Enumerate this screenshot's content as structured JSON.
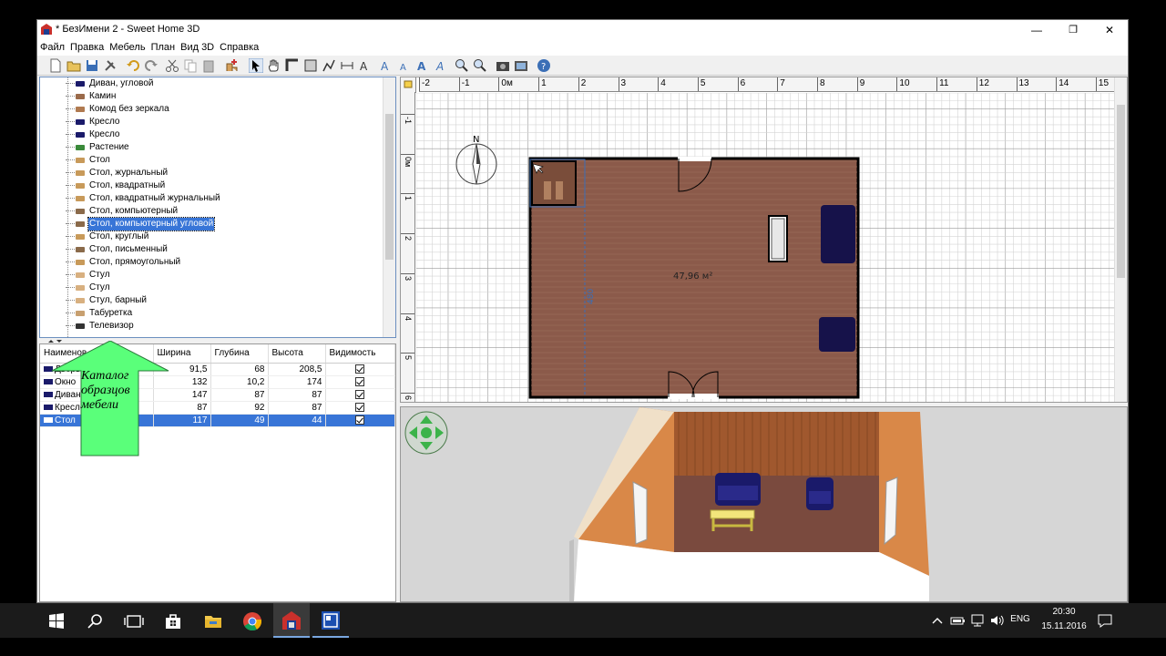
{
  "window": {
    "title": "* БезИмени 2 - Sweet Home 3D",
    "controls": {
      "minimize": "—",
      "maximize": "❐",
      "close": "✕"
    }
  },
  "menu": [
    "Файл",
    "Правка",
    "Мебель",
    "План",
    "Вид 3D",
    "Справка"
  ],
  "catalog": {
    "items": [
      {
        "label": "Диван, угловой",
        "icon": "sofa-icon"
      },
      {
        "label": "Камин",
        "icon": "fireplace-icon"
      },
      {
        "label": "Комод без зеркала",
        "icon": "dresser-icon"
      },
      {
        "label": "Кресло",
        "icon": "armchair-icon"
      },
      {
        "label": "Кресло",
        "icon": "armchair-icon"
      },
      {
        "label": "Растение",
        "icon": "plant-icon"
      },
      {
        "label": "Стол",
        "icon": "table-icon"
      },
      {
        "label": "Стол, журнальный",
        "icon": "table-icon"
      },
      {
        "label": "Стол, квадратный",
        "icon": "table-icon"
      },
      {
        "label": "Стол, квадратный журнальный",
        "icon": "table-icon"
      },
      {
        "label": "Стол, компьютерный",
        "icon": "desk-icon"
      },
      {
        "label": "Стол, компьютерный угловой",
        "icon": "desk-icon",
        "selected": true
      },
      {
        "label": "Стол, круглый",
        "icon": "table-icon"
      },
      {
        "label": "Стол, письменный",
        "icon": "desk-icon"
      },
      {
        "label": "Стол, прямоугольный",
        "icon": "table-icon"
      },
      {
        "label": "Стул",
        "icon": "chair-icon"
      },
      {
        "label": "Стул",
        "icon": "chair-icon"
      },
      {
        "label": "Стул, барный",
        "icon": "chair-icon"
      },
      {
        "label": "Табуретка",
        "icon": "stool-icon"
      },
      {
        "label": "Телевизор",
        "icon": "tv-icon"
      }
    ]
  },
  "furniture_table": {
    "headers": [
      "Наименов",
      "Ширина",
      "Глубина",
      "Высота",
      "Видимость"
    ],
    "rows": [
      {
        "name": "Дверь",
        "width": "91,5",
        "depth": "68",
        "height": "208,5",
        "visible": true,
        "icon": "door-icon"
      },
      {
        "name": "Окно",
        "width": "132",
        "depth": "10,2",
        "height": "174",
        "visible": true,
        "icon": "window-icon"
      },
      {
        "name": "Диван",
        "width": "147",
        "depth": "87",
        "height": "87",
        "visible": true,
        "icon": "sofa-icon"
      },
      {
        "name": "Кресло",
        "width": "87",
        "depth": "92",
        "height": "87",
        "visible": true,
        "icon": "armchair-icon"
      },
      {
        "name": "Стол",
        "width": "117",
        "depth": "49",
        "height": "44",
        "visible": true,
        "icon": "table-icon",
        "selected": true
      }
    ]
  },
  "annotation": {
    "text": "Каталог образцов мебели",
    "color": "#5aff7a"
  },
  "plan": {
    "ruler_x_labels": [
      "-2",
      "-1",
      "0м",
      "1",
      "2",
      "3",
      "4",
      "5",
      "6",
      "7",
      "8",
      "9",
      "10",
      "11",
      "12",
      "13",
      "14",
      "15"
    ],
    "ruler_y_labels": [
      "-1",
      "0м",
      "1",
      "2",
      "3",
      "4",
      "5",
      "6"
    ],
    "room_area": "47,96 м²",
    "compass_label": "N",
    "floor_color": "#8b5a4a",
    "dimension_label": "480"
  },
  "taskbar": {
    "language": "ENG",
    "time": "20:30",
    "date": "15.11.2016"
  },
  "colors": {
    "selection": "#3875d7",
    "sofa": "#16124a"
  }
}
